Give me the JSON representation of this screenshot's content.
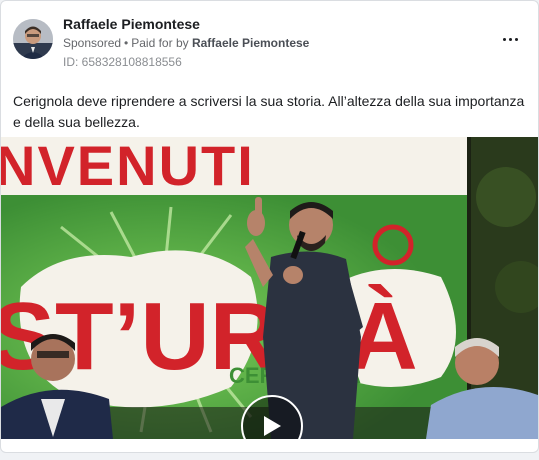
{
  "post": {
    "author": "Raffaele Piemontese",
    "sponsored_label": "Sponsored",
    "separator": "•",
    "paid_for_prefix": "Paid for by",
    "paid_for_name": "Raffaele Piemontese",
    "id_text": "ID: 658328108818556",
    "message": "Cerignola deve riprendere a scriversi la sua storia. All’altezza della sua importanza e della sua bellezza.",
    "more_icon": "more-horizontal-icon",
    "play_icon": "play-icon"
  },
  "video_frame": {
    "banner_top_text": "NVENUTI",
    "banner_big_text": "ST’URNÀ",
    "banner_small_text": "CERIGNOLA",
    "colors": {
      "banner_red": "#d2232a",
      "banner_green": "#4aa23f",
      "banner_white": "#f5f2ea"
    }
  }
}
